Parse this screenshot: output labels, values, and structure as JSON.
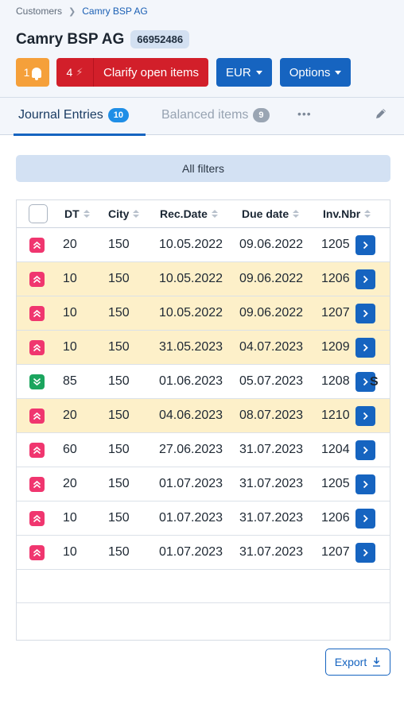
{
  "breadcrumb": {
    "root": "Customers",
    "current": "Camry BSP AG"
  },
  "customer": {
    "name": "Camry BSP AG",
    "id": "66952486"
  },
  "actions": {
    "notifications_count": "1",
    "issues_count": "4",
    "clarify_label": "Clarify open items",
    "currency": "EUR",
    "options_label": "Options"
  },
  "tabs": [
    {
      "label": "Journal Entries",
      "count": "10",
      "active": true
    },
    {
      "label": "Balanced items",
      "count": "9",
      "active": false
    }
  ],
  "more_label": "•••",
  "filters_label": "All filters",
  "table": {
    "columns": [
      "DT",
      "City",
      "Rec.Date",
      "Due date",
      "Inv.Nbr"
    ],
    "rows": [
      {
        "priority": "up",
        "dt": "20",
        "city": "150",
        "rec_date": "10.05.2022",
        "due_date": "09.06.2022",
        "inv": "1205",
        "highlight": false
      },
      {
        "priority": "up",
        "dt": "10",
        "city": "150",
        "rec_date": "10.05.2022",
        "due_date": "09.06.2022",
        "inv": "1206",
        "highlight": true
      },
      {
        "priority": "up",
        "dt": "10",
        "city": "150",
        "rec_date": "10.05.2022",
        "due_date": "09.06.2022",
        "inv": "1207",
        "highlight": true
      },
      {
        "priority": "up",
        "dt": "10",
        "city": "150",
        "rec_date": "31.05.2023",
        "due_date": "04.07.2023",
        "inv": "1209",
        "highlight": true
      },
      {
        "priority": "down",
        "dt": "85",
        "city": "150",
        "rec_date": "01.06.2023",
        "due_date": "05.07.2023",
        "inv": "1208",
        "highlight": false
      },
      {
        "priority": "up",
        "dt": "20",
        "city": "150",
        "rec_date": "04.06.2023",
        "due_date": "08.07.2023",
        "inv": "1210",
        "highlight": true
      },
      {
        "priority": "up",
        "dt": "60",
        "city": "150",
        "rec_date": "27.06.2023",
        "due_date": "31.07.2023",
        "inv": "1204",
        "highlight": false
      },
      {
        "priority": "up",
        "dt": "20",
        "city": "150",
        "rec_date": "01.07.2023",
        "due_date": "31.07.2023",
        "inv": "1205",
        "highlight": false
      },
      {
        "priority": "up",
        "dt": "10",
        "city": "150",
        "rec_date": "01.07.2023",
        "due_date": "31.07.2023",
        "inv": "1206",
        "highlight": false
      },
      {
        "priority": "up",
        "dt": "10",
        "city": "150",
        "rec_date": "01.07.2023",
        "due_date": "31.07.2023",
        "inv": "1207",
        "highlight": false
      }
    ],
    "footer_cut_text": "S"
  },
  "export_label": "Export",
  "colors": {
    "accent": "#1664c0",
    "danger": "#d21f2a",
    "warning": "#f5a03a",
    "priority_up": "#f0366f",
    "priority_down": "#1ba55e",
    "row_highlight": "#fdf0c9"
  },
  "icons": {
    "breadcrumb_separator": "chevron-right-icon",
    "notification": "bell-icon",
    "issue": "bolt-icon",
    "edit": "pencil-icon",
    "sort": "sort-icon",
    "priority_up": "double-chevron-up-icon",
    "priority_down": "double-chevron-down-icon",
    "row_action": "chevron-right-icon",
    "export": "download-icon"
  }
}
